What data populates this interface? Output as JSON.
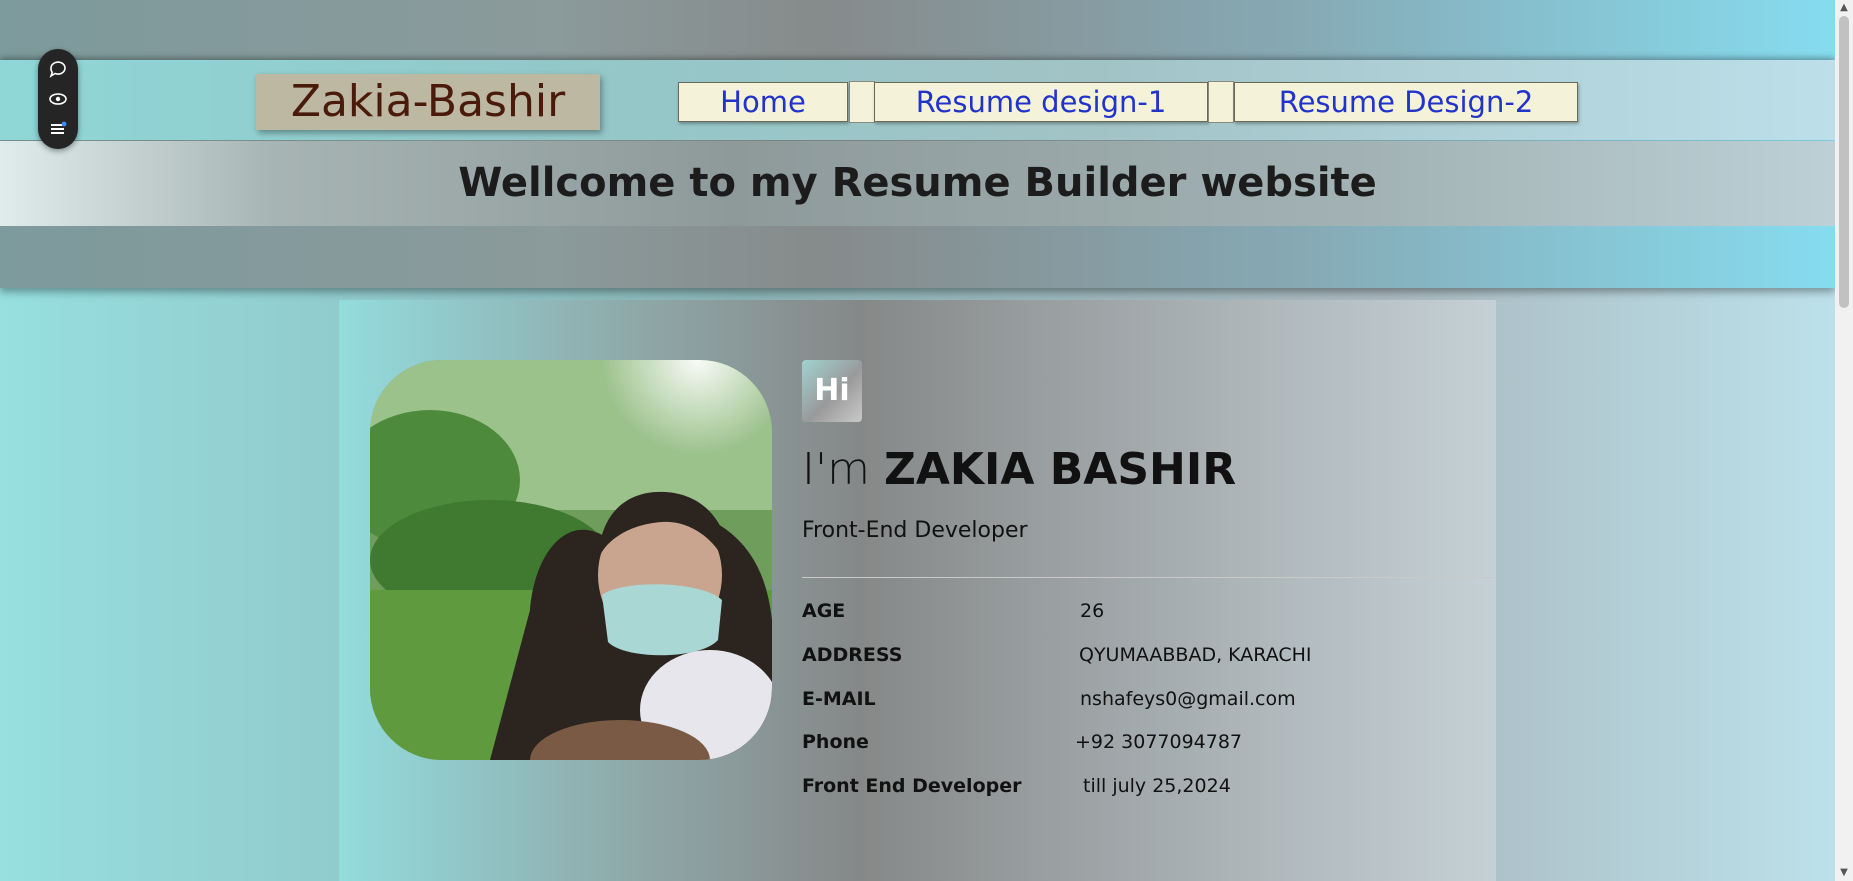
{
  "site": {
    "brand": "Zakia-Bashir",
    "nav": [
      {
        "label": "Home"
      },
      {
        "label": "Resume design-1"
      },
      {
        "label": "Resume Design-2"
      }
    ],
    "welcome": "Wellcome to my Resume Builder website"
  },
  "profile": {
    "badge": "Hi",
    "greeting": "I'm",
    "name": "ZAKIA BASHIR",
    "role": "Front-End Developer",
    "info": [
      {
        "key": "AGE",
        "value": "26"
      },
      {
        "key": "ADDRESS",
        "value": "QYUMAABBAD, KARACHI"
      },
      {
        "key": "E-MAIL",
        "value": "nshafeys0@gmail.com"
      },
      {
        "key": "Phone",
        "value": "+92 3077094787"
      },
      {
        "key": "Front End Developer",
        "value": "till july 25,2024"
      }
    ]
  },
  "toolbar": {
    "items": [
      "chat-bubble-icon",
      "eye-icon",
      "menu-list-icon"
    ]
  },
  "colors": {
    "brand_text": "#4a1a0a",
    "brand_bg": "#bdb8a2",
    "nav_text": "#2233cc",
    "nav_bg": "#f4f3da",
    "toolbar_bg": "#252525"
  }
}
